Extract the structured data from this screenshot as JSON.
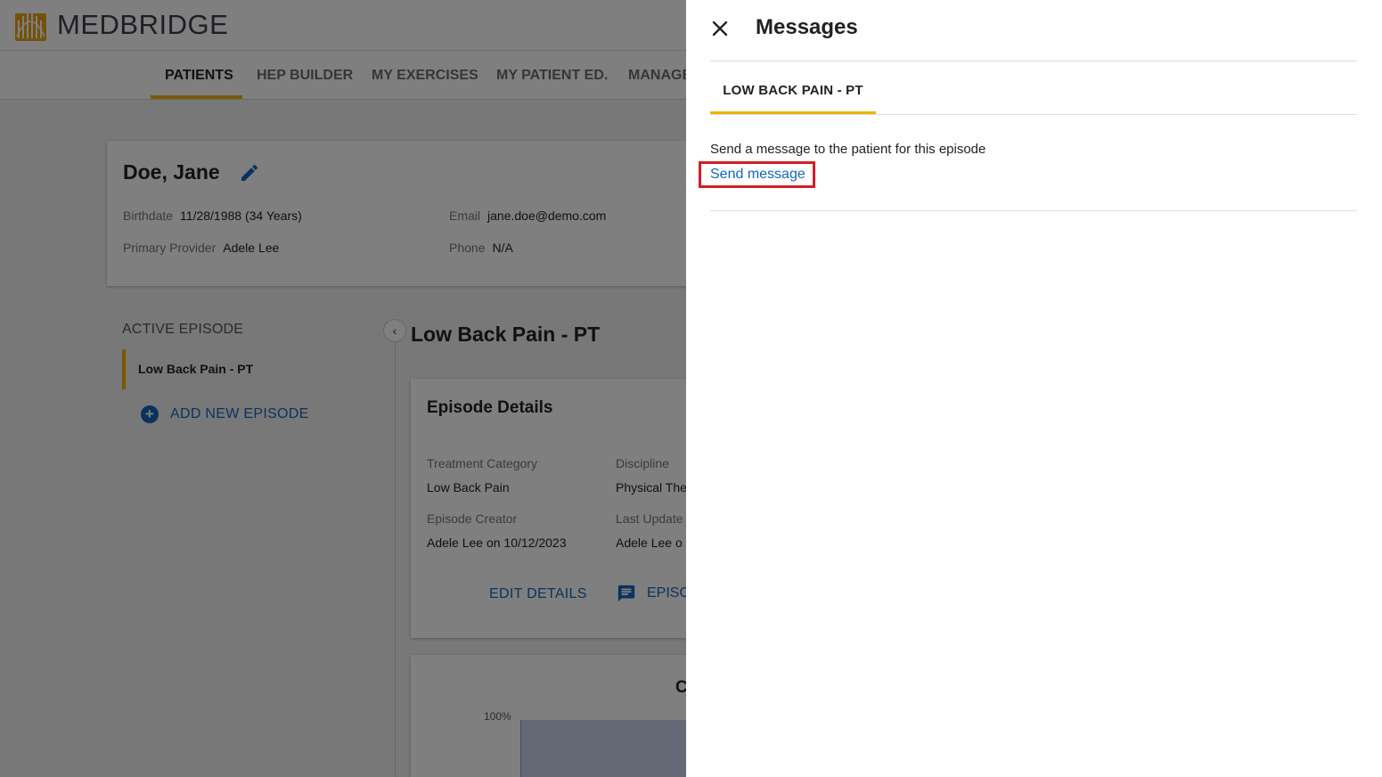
{
  "app": {
    "brand": "MEDBRIDGE",
    "nav": [
      {
        "label": "PATIENTS",
        "active": true
      },
      {
        "label": "HEP BUILDER"
      },
      {
        "label": "MY EXERCISES"
      },
      {
        "label": "MY PATIENT ED."
      },
      {
        "label": "MANAGE"
      }
    ],
    "accent_color": "#f0b400",
    "link_color": "#1565c0"
  },
  "patient": {
    "name": "Doe, Jane",
    "birthdate_label": "Birthdate",
    "birthdate": "11/28/1988 (34 Years)",
    "provider_label": "Primary Provider",
    "provider": "Adele Lee",
    "email_label": "Email",
    "email": "jane.doe@demo.com",
    "phone_label": "Phone",
    "phone": "N/A"
  },
  "episodes": {
    "heading": "ACTIVE EPISODE",
    "active": "Low Back Pain - PT",
    "add_label": "ADD NEW EPISODE"
  },
  "episode_panel": {
    "title": "Low Back Pain - PT",
    "details_heading": "Episode Details",
    "treatment_category_label": "Treatment Category",
    "treatment_category": "Low Back Pain",
    "discipline_label": "Discipline",
    "discipline": "Physical The",
    "creator_label": "Episode Creator",
    "creator": "Adele Lee on 10/12/2023",
    "last_updated_label": "Last Update",
    "last_updated": "Adele Lee o",
    "edit_details_label": "EDIT DETAILS",
    "episode_messages_label": "EPISO",
    "chart_tick": "100%",
    "chart_title_fragment": "C"
  },
  "drawer": {
    "title": "Messages",
    "tab_label": "LOW BACK PAIN - PT",
    "info_text": "Send a message to the patient for this episode",
    "send_link": "Send message"
  }
}
